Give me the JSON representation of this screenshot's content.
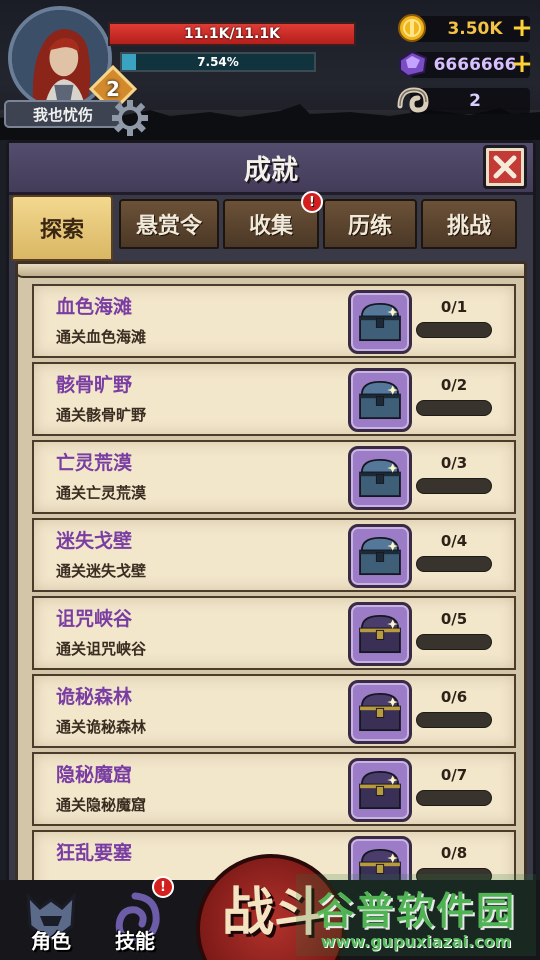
{
  "player": {
    "name": "我也忧伤",
    "level": "2",
    "hp_text": "11.1K/11.1K",
    "hp_fraction": 1.0,
    "xp_text": "7.54%",
    "xp_fraction": 0.0754
  },
  "resources": {
    "gold": {
      "value": "3.50K",
      "icon": "gold-coin-icon"
    },
    "gems": {
      "value": "6666666",
      "icon": "purple-crystal-icon"
    },
    "horns": {
      "value": "2",
      "icon": "ram-horn-icon"
    }
  },
  "panel": {
    "title": "成就",
    "tabs": [
      {
        "label": "探索",
        "active": true,
        "badge": false
      },
      {
        "label": "悬赏令",
        "active": false,
        "badge": false
      },
      {
        "label": "收集",
        "active": false,
        "badge": true,
        "badge_text": "!"
      },
      {
        "label": "历练",
        "active": false,
        "badge": false
      },
      {
        "label": "挑战",
        "active": false,
        "badge": false
      }
    ]
  },
  "achievements": [
    {
      "name": "血色海滩",
      "desc": "通关血色海滩",
      "progress": "0/1",
      "fraction": 0,
      "chest": "blue"
    },
    {
      "name": "骸骨旷野",
      "desc": "通关骸骨旷野",
      "progress": "0/2",
      "fraction": 0,
      "chest": "blue"
    },
    {
      "name": "亡灵荒漠",
      "desc": "通关亡灵荒漠",
      "progress": "0/3",
      "fraction": 0,
      "chest": "blue"
    },
    {
      "name": "迷失戈壁",
      "desc": "通关迷失戈壁",
      "progress": "0/4",
      "fraction": 0,
      "chest": "blue"
    },
    {
      "name": "诅咒峡谷",
      "desc": "通关诅咒峡谷",
      "progress": "0/5",
      "fraction": 0,
      "chest": "purple"
    },
    {
      "name": "诡秘森林",
      "desc": "通关诡秘森林",
      "progress": "0/6",
      "fraction": 0,
      "chest": "purple"
    },
    {
      "name": "隐秘魔窟",
      "desc": "通关隐秘魔窟",
      "progress": "0/7",
      "fraction": 0,
      "chest": "purple"
    },
    {
      "name": "狂乱要塞",
      "desc": "",
      "progress": "0/8",
      "fraction": 0,
      "chest": "purple"
    }
  ],
  "bottom_nav": {
    "character": "角色",
    "skills": "技能",
    "skills_badge": "!",
    "battle": "战斗"
  },
  "watermark": {
    "title": "谷普软件园",
    "url": "www.gupuxiazai.com"
  },
  "colors": {
    "name_purple": "#7a3ea3",
    "active_tab": "#f3d88f",
    "hp_red": "#e03c34",
    "xp_cyan": "#3aa3c2",
    "badge_red": "#d3201f",
    "close_red": "#c33a36"
  }
}
